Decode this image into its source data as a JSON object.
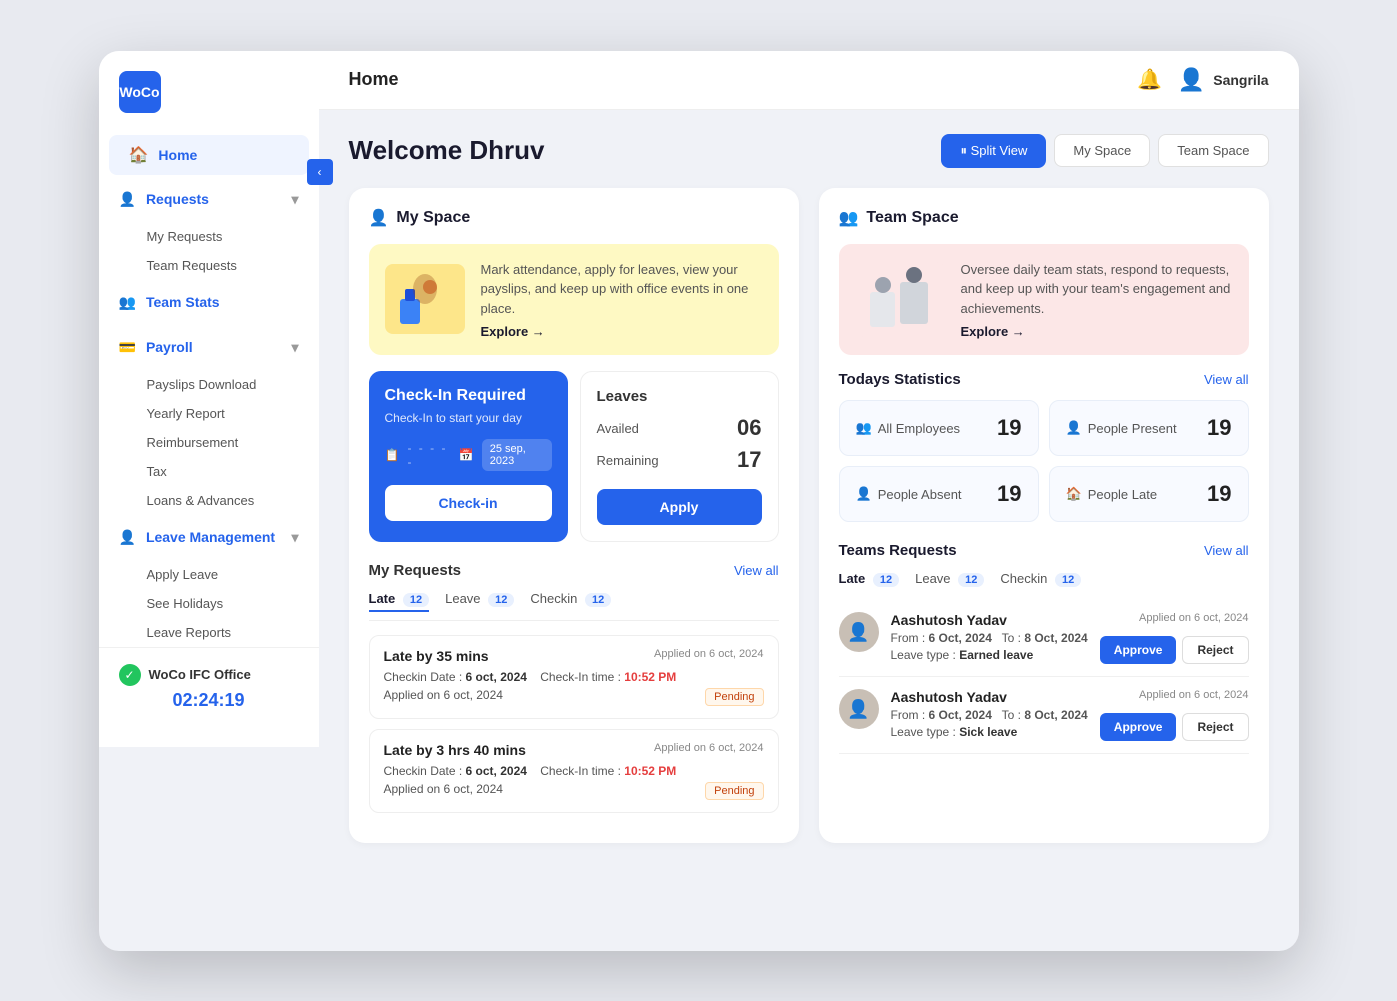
{
  "app": {
    "logo": "WoCo",
    "topbar": {
      "title": "Home",
      "user": "Sangrila"
    }
  },
  "sidebar": {
    "nav_items": [
      {
        "id": "home",
        "label": "Home",
        "icon": "🏠",
        "active": true
      },
      {
        "id": "requests",
        "label": "Requests",
        "icon": "👤",
        "expandable": true
      },
      {
        "id": "my-requests",
        "label": "My Requests",
        "sub": true
      },
      {
        "id": "team-requests",
        "label": "Team Requests",
        "sub": true
      },
      {
        "id": "team-stats",
        "label": "Team Stats",
        "icon": "👥"
      },
      {
        "id": "payroll",
        "label": "Payroll",
        "icon": "💳",
        "expandable": true
      },
      {
        "id": "payslips",
        "label": "Payslips Download",
        "sub": true
      },
      {
        "id": "yearly",
        "label": "Yearly Report",
        "sub": true
      },
      {
        "id": "reimbursement",
        "label": "Reimbursement",
        "sub": true
      },
      {
        "id": "tax",
        "label": "Tax",
        "sub": true
      },
      {
        "id": "loans",
        "label": "Loans & Advances",
        "sub": true
      },
      {
        "id": "leave-mgmt",
        "label": "Leave Management",
        "icon": "👤",
        "expandable": true
      },
      {
        "id": "apply-leave",
        "label": "Apply Leave",
        "sub": true
      },
      {
        "id": "holidays",
        "label": "See Holidays",
        "sub": true
      },
      {
        "id": "leave-reports",
        "label": "Leave Reports",
        "sub": true
      }
    ],
    "office": {
      "name": "WoCo IFC Office",
      "time": "02:24:19"
    }
  },
  "dashboard": {
    "welcome": "Welcome Dhruv",
    "view_tabs": [
      {
        "id": "split",
        "label": "⏸ Split View",
        "active": true
      },
      {
        "id": "myspace",
        "label": "My Space",
        "active": false
      },
      {
        "id": "teamspace",
        "label": "Team Space",
        "active": false
      }
    ]
  },
  "my_space": {
    "title": "My Space",
    "banner": {
      "text": "Mark attendance, apply for leaves, view your payslips, and keep up with office events in one place.",
      "explore": "Explore →"
    },
    "checkin": {
      "title": "Check-In Required",
      "subtitle": "Check-In to start your day",
      "date": "25 sep, 2023",
      "btn_label": "Check-in"
    },
    "leaves": {
      "title": "Leaves",
      "availed_label": "Availed",
      "availed_val": "06",
      "remaining_label": "Remaining",
      "remaining_val": "17",
      "apply_btn": "Apply"
    },
    "requests": {
      "title": "My Requests",
      "view_all": "View all",
      "tabs": [
        {
          "id": "late",
          "label": "Late",
          "count": "12",
          "active": true
        },
        {
          "id": "leave",
          "label": "Leave",
          "count": "12",
          "active": false
        },
        {
          "id": "checkin",
          "label": "Checkin",
          "count": "12",
          "active": false
        }
      ],
      "items": [
        {
          "title": "Late by 35 mins",
          "applied": "Applied on 6 oct, 2024",
          "checkin_date": "6 oct, 2024",
          "checkin_time": "10:52 PM",
          "applied_on": "Applied on 6 oct, 2024",
          "status": "Pending"
        },
        {
          "title": "Late by 3 hrs 40 mins",
          "applied": "Applied on 6 oct, 2024",
          "checkin_date": "6 oct, 2024",
          "checkin_time": "10:52 PM",
          "applied_on": "Applied on 6 oct, 2024",
          "status": "Pending"
        }
      ]
    }
  },
  "team_space": {
    "title": "Team Space",
    "banner": {
      "text": "Oversee daily team stats, respond to requests, and keep up with your team's engagement and achievements.",
      "explore": "Explore →"
    },
    "todays_stats": {
      "title": "Todays Statistics",
      "view_all": "View all",
      "stats": [
        {
          "id": "all-employees",
          "label": "All Employees",
          "value": "19",
          "icon": "👥"
        },
        {
          "id": "people-present",
          "label": "People Present",
          "value": "19",
          "icon": "👤"
        },
        {
          "id": "people-absent",
          "label": "People Absent",
          "value": "19",
          "icon": "👤"
        },
        {
          "id": "people-late",
          "label": "People Late",
          "value": "19",
          "icon": "🏠"
        }
      ]
    },
    "requests": {
      "title": "Teams Requests",
      "view_all": "View all",
      "tabs": [
        {
          "id": "late",
          "label": "Late",
          "count": "12",
          "active": true
        },
        {
          "id": "leave",
          "label": "Leave",
          "count": "12",
          "active": false
        },
        {
          "id": "checkin",
          "label": "Checkin",
          "count": "12",
          "active": false
        }
      ],
      "items": [
        {
          "name": "Aashutosh Yadav",
          "applied": "Applied on 6 oct, 2024",
          "from": "6 Oct, 2024",
          "to": "8 Oct, 2024",
          "leave_type": "Earned leave",
          "approve_label": "Approve",
          "reject_label": "Reject"
        },
        {
          "name": "Aashutosh Yadav",
          "applied": "Applied on 6 oct, 2024",
          "from": "6 Oct, 2024",
          "to": "8 Oct, 2024",
          "leave_type": "Sick leave",
          "approve_label": "Approve",
          "reject_label": "Reject"
        }
      ]
    }
  }
}
